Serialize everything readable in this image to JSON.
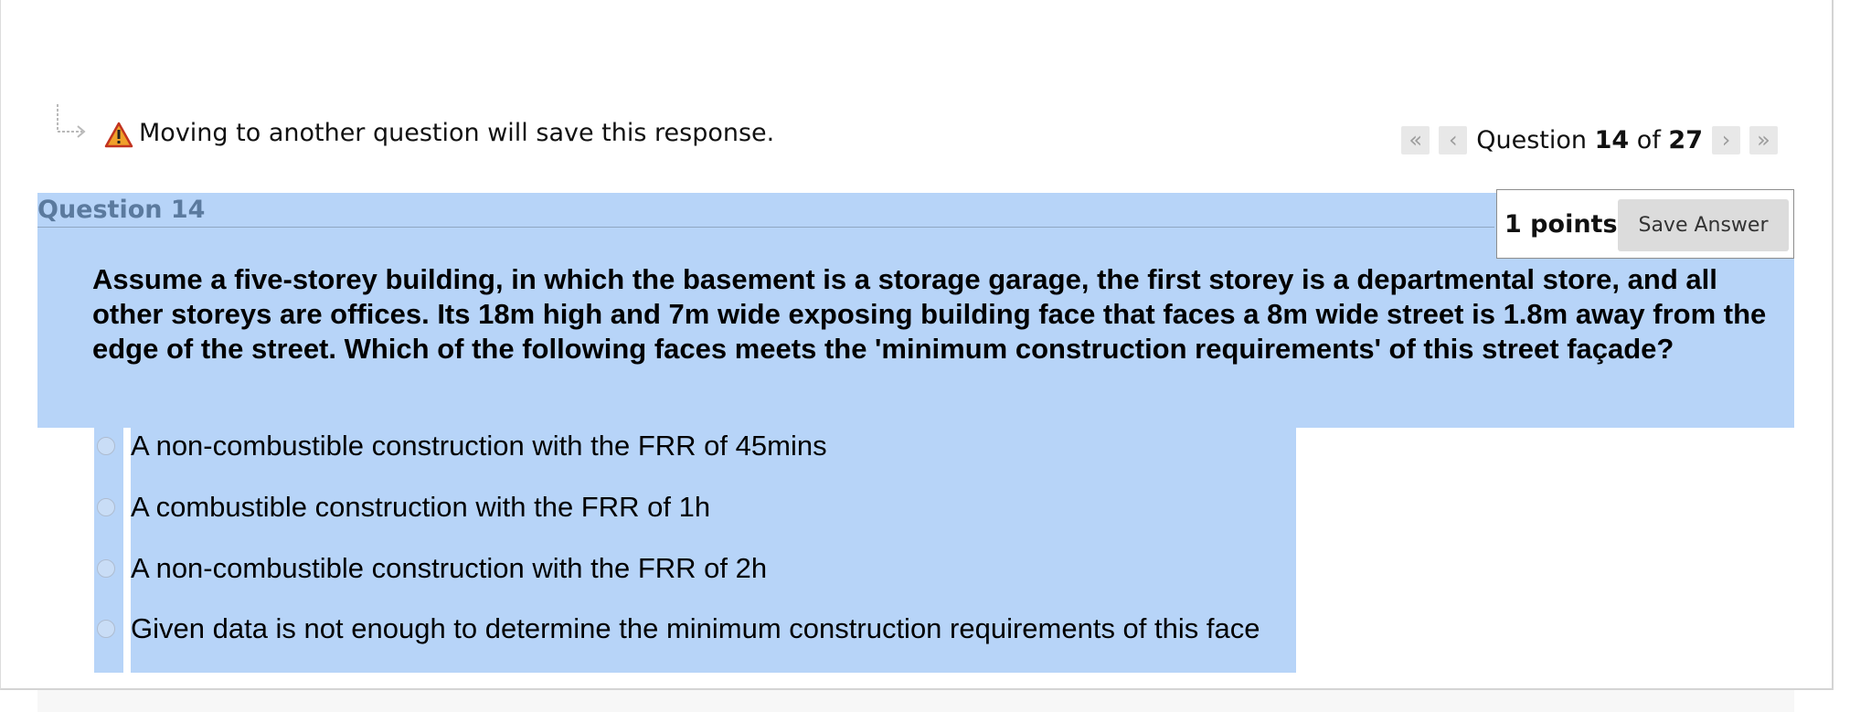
{
  "notice": {
    "text": "Moving to another question will save this response."
  },
  "navigation": {
    "prefix": "Question",
    "current": "14",
    "separator": "of",
    "total": "27",
    "first_icon": "«",
    "prev_icon": "‹",
    "next_icon": "›",
    "last_icon": "»"
  },
  "question": {
    "title": "Question 14",
    "points": "1 points",
    "save_label": "Save Answer",
    "text": "Assume a five-storey building, in which the basement is a storage garage, the first storey is a departmental store, and all other storeys are offices. Its 18m high and 7m wide exposing building face that faces a 8m wide street is 1.8m away from the edge of the street. Which of the following faces meets the 'minimum construction requirements' of this street façade?",
    "options": [
      "A non-combustible construction with the FRR of 45mins",
      "A combustible construction with the FRR of 1h",
      "A non-combustible construction with the FRR of 2h",
      "Given data is not enough to determine the minimum construction requirements of this face"
    ]
  },
  "colors": {
    "selection_highlight": "#b7d4f8",
    "warning": "#f0a02a"
  },
  "icons": {
    "branch": "branch-arrow-icon",
    "warning": "warning-icon"
  }
}
